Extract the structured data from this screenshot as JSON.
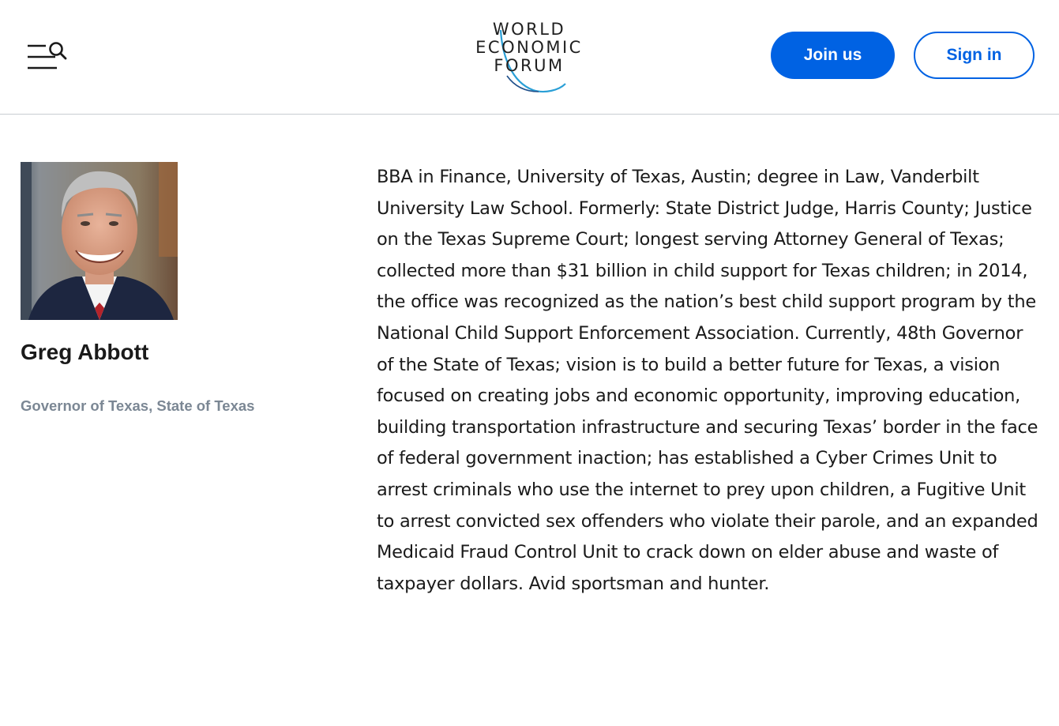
{
  "header": {
    "logo_lines": [
      "WORLD",
      "ECONOMIC",
      "FORUM"
    ],
    "menu_icon": "menu-search-icon",
    "join_label": "Join us",
    "signin_label": "Sign in",
    "accent_color": "#0062e3"
  },
  "profile": {
    "name": "Greg Abbott",
    "role": "Governor of Texas, State of Texas",
    "photo_alt": "portrait",
    "bio": "BBA in Finance, University of Texas, Austin; degree in Law, Vanderbilt University Law School. Formerly: State District Judge, Harris County; Justice on the Texas Supreme Court; longest serving Attorney General of Texas; collected more than $31 billion in child support for Texas children; in 2014, the office was recognized as the nation’s best child support program by the National Child Support Enforcement Association. Currently, 48th Governor of the State of Texas; vision is to build a better future for Texas, a vision focused on creating jobs and economic opportunity, improving education, building transportation infrastructure and securing Texas’ border in the face of federal government inaction; has established a Cyber Crimes Unit to arrest criminals who use the internet to prey upon children, a Fugitive Unit to arrest convicted sex offenders who violate their parole, and an expanded Medicaid Fraud Control Unit to crack down on elder abuse and waste of taxpayer dollars. Avid sportsman and hunter."
  }
}
